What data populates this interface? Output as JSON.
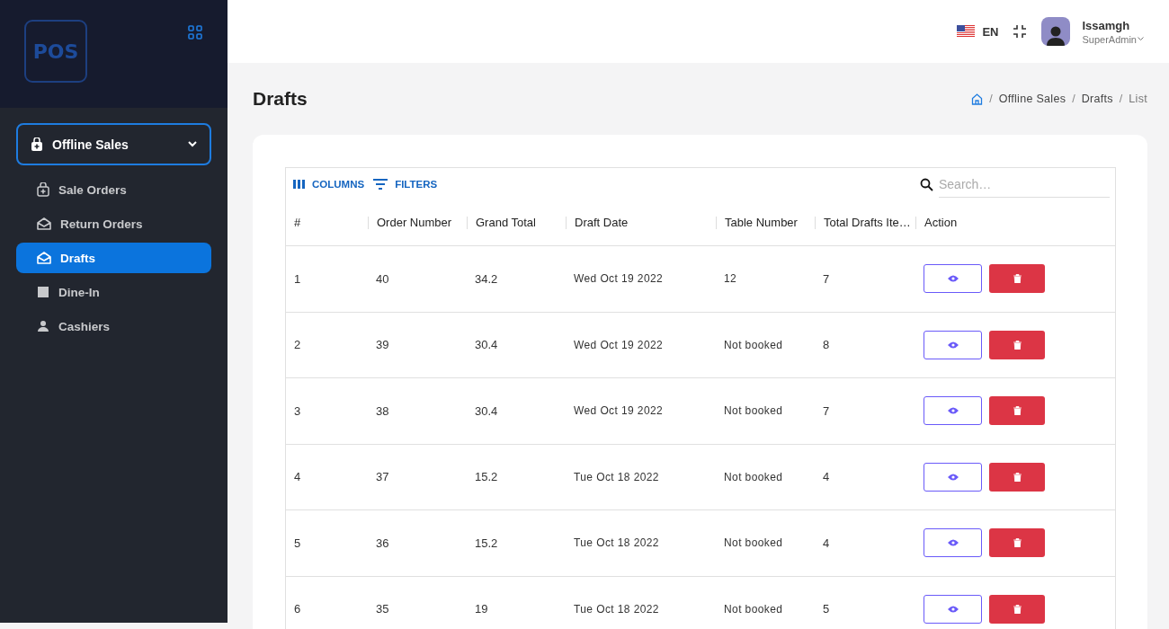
{
  "logo": {
    "text": "POS"
  },
  "sidebar": {
    "group": {
      "label": "Offline Sales",
      "expanded": true
    },
    "items": [
      {
        "label": "Sale Orders",
        "kind": "bag",
        "selected": false
      },
      {
        "label": "Return Orders",
        "kind": "envelope",
        "selected": false
      },
      {
        "label": "Drafts",
        "kind": "envelope",
        "selected": true
      },
      {
        "label": "Dine-In",
        "kind": "square",
        "selected": false
      },
      {
        "label": "Cashiers",
        "kind": "person",
        "selected": false
      }
    ]
  },
  "topbar": {
    "language": "EN",
    "user": {
      "name": "Issamgh",
      "role": "SuperAdmin"
    }
  },
  "page": {
    "title": "Drafts",
    "breadcrumb": [
      "Offline Sales",
      "Drafts",
      "List"
    ],
    "breadcrumb_separator": "/"
  },
  "toolbar": {
    "columns": "COLUMNS",
    "filters": "FILTERS",
    "search": {
      "placeholder": "Search…"
    }
  },
  "table": {
    "columns": [
      "#",
      "Order Number",
      "Grand Total",
      "Draft Date",
      "Table Number",
      "Total Drafts Ite…",
      "Action"
    ],
    "rows": [
      [
        "1",
        "40",
        "34.2",
        "Wed Oct 19 2022",
        "12",
        "7"
      ],
      [
        "2",
        "39",
        "30.4",
        "Wed Oct 19 2022",
        "Not booked",
        "8"
      ],
      [
        "3",
        "38",
        "30.4",
        "Wed Oct 19 2022",
        "Not booked",
        "7"
      ],
      [
        "4",
        "37",
        "15.2",
        "Tue Oct 18 2022",
        "Not booked",
        "4"
      ],
      [
        "5",
        "36",
        "15.2",
        "Tue Oct 18 2022",
        "Not booked",
        "4"
      ],
      [
        "6",
        "35",
        "19",
        "Tue Oct 18 2022",
        "Not booked",
        "5"
      ]
    ]
  }
}
